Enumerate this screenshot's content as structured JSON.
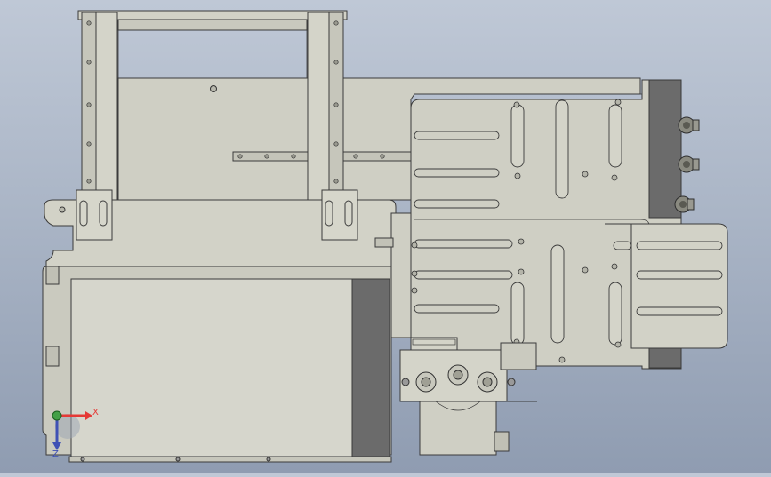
{
  "viewport": {
    "background_top": "#bfc8d6",
    "background_bottom": "#8f9cb1"
  },
  "colors": {
    "part_fill": "#cfcfc4",
    "part_fill_light": "#d7d7cd",
    "part_fill_dark": "#b9b9ad",
    "edge": "#3b3b3b",
    "dark_block": "#6b6b6b",
    "dark_block_edge": "#3a3a3a",
    "axis_x": "#e53935",
    "axis_y": "#3f51b5",
    "axis_origin": "#43a047"
  },
  "triad": {
    "x_label": "X",
    "y_label": "Z",
    "origin_icon": "axis-origin-icon"
  },
  "icons": {
    "connector": "pneumatic-fitting-icon",
    "bolt": "bolt-head-icon",
    "slot": "slot-icon"
  }
}
